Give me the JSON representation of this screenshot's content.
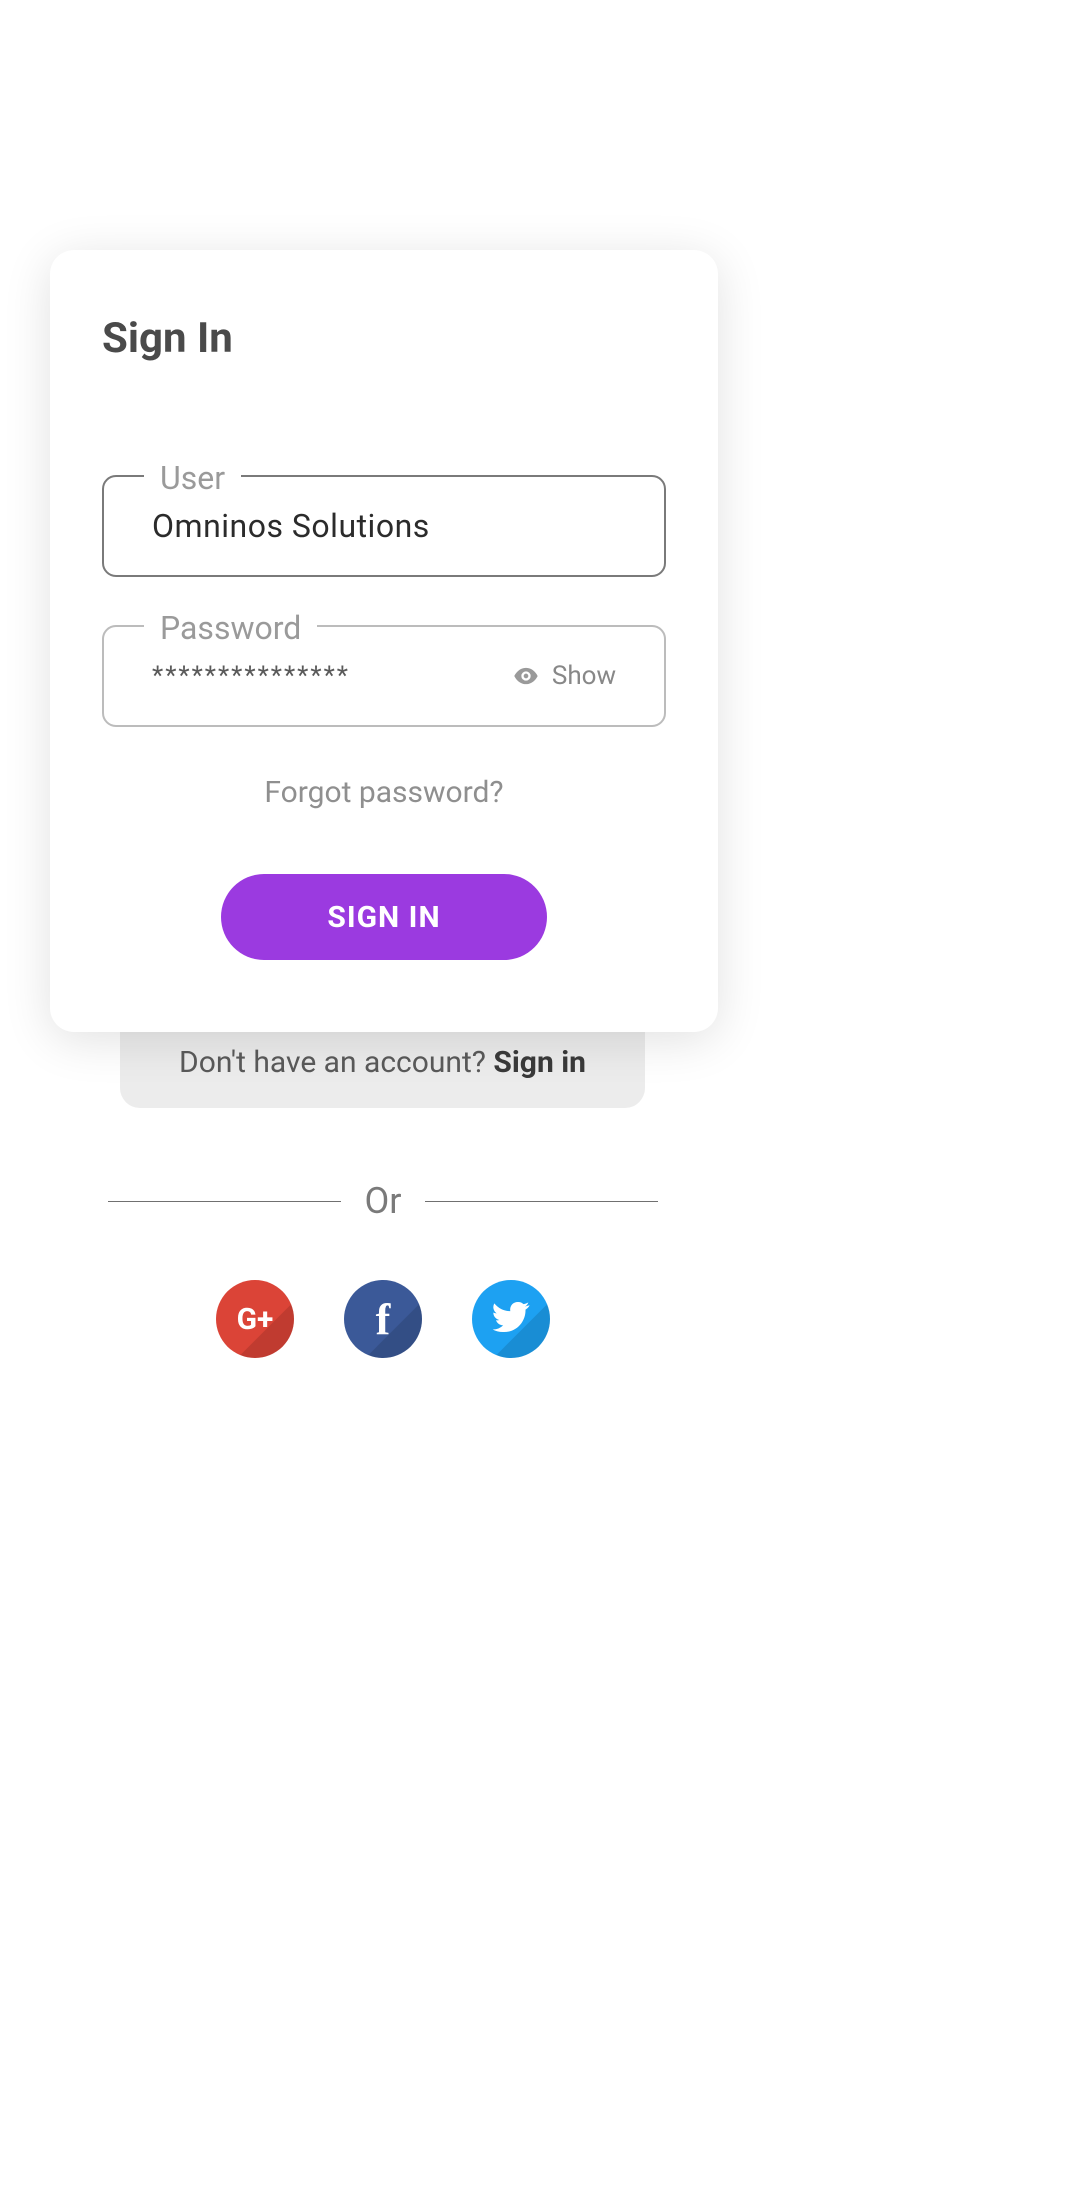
{
  "title": "Sign In",
  "user": {
    "label": "User",
    "value": "Omninos Solutions"
  },
  "password": {
    "label": "Password",
    "mask": "***************",
    "show_label": "Show"
  },
  "forgot": "Forgot password?",
  "signin_btn": "SIGN IN",
  "signup": {
    "prompt": "Don't have an account? ",
    "action": "Sign in"
  },
  "or": "Or",
  "social": {
    "google": "G+",
    "facebook": "f",
    "twitter": "twitter"
  }
}
